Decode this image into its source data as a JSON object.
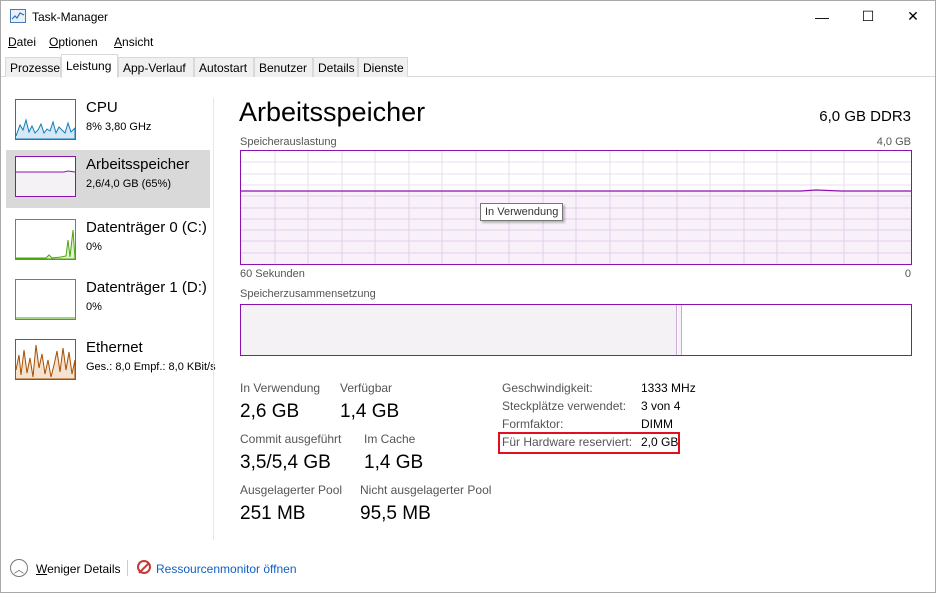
{
  "window": {
    "title": "Task-Manager",
    "controls": {
      "minimize": "—",
      "maximize": "☐",
      "close": "✕"
    }
  },
  "menu": [
    {
      "accel": "D",
      "rest": "atei"
    },
    {
      "accel": "O",
      "rest": "ptionen"
    },
    {
      "accel": "A",
      "rest": "nsicht"
    }
  ],
  "tabs": [
    "Prozesse",
    "Leistung",
    "App-Verlauf",
    "Autostart",
    "Benutzer",
    "Details",
    "Dienste"
  ],
  "active_tab": "Leistung",
  "sidebar": {
    "items": [
      {
        "title": "CPU",
        "sub": "8%  3,80 GHz",
        "color": "#117dbb"
      },
      {
        "title": "Arbeitsspeicher",
        "sub": "2,6/4,0 GB (65%)",
        "color": "#8b12ae"
      },
      {
        "title": "Datenträger 0 (C:)",
        "sub": "0%",
        "color": "#4da60c"
      },
      {
        "title": "Datenträger 1 (D:)",
        "sub": "0%",
        "color": "#4da60c"
      },
      {
        "title": "Ethernet",
        "sub": "Ges.: 8,0  Empf.: 8,0 KBit/s",
        "color": "#a74f01"
      }
    ]
  },
  "main": {
    "title": "Arbeitsspeicher",
    "spec": "6,0 GB DDR3",
    "usage_chart": {
      "label": "Speicherauslastung",
      "max_label": "4,0 GB",
      "time_left": "60 Sekunden",
      "time_right": "0",
      "in_use_fraction": 0.65,
      "tooltip": "In Verwendung"
    },
    "composition": {
      "label": "Speicherzusammensetzung",
      "in_use_fraction": 0.65
    },
    "stats": {
      "in_use": {
        "label": "In Verwendung",
        "value": "2,6 GB"
      },
      "available": {
        "label": "Verfügbar",
        "value": "1,4 GB"
      },
      "committed": {
        "label": "Commit ausgeführt",
        "value": "3,5/5,4 GB"
      },
      "cached": {
        "label": "Im Cache",
        "value": "1,4 GB"
      },
      "paged_pool": {
        "label": "Ausgelagerter Pool",
        "value": "251 MB"
      },
      "nonpaged_pool": {
        "label": "Nicht ausgelagerter Pool",
        "value": "95,5 MB"
      }
    },
    "specs": [
      {
        "label": "Geschwindigkeit:",
        "value": "1333 MHz"
      },
      {
        "label": "Steckplätze verwendet:",
        "value": "3 von 4"
      },
      {
        "label": "Formfaktor:",
        "value": "DIMM"
      },
      {
        "label": "Für Hardware reserviert:",
        "value": "2,0 GB"
      }
    ],
    "highlight_color": "#e01020"
  },
  "footer": {
    "less_details_accel": "W",
    "less_details_rest": "eniger Details",
    "resource_monitor": "Ressourcenmonitor öffnen",
    "link_color": "#0f5fc4"
  }
}
